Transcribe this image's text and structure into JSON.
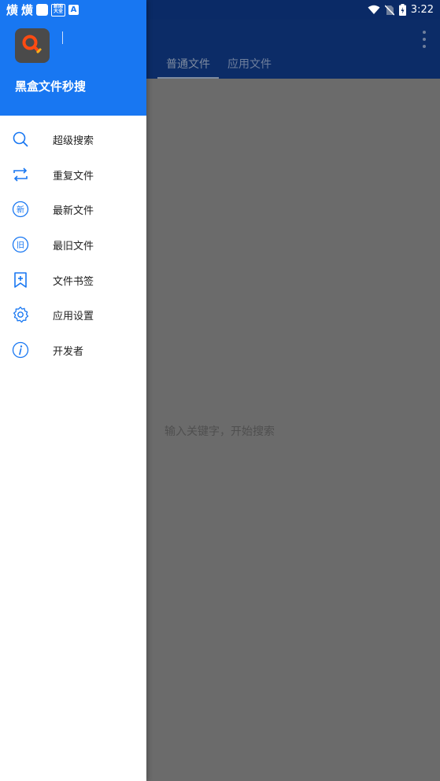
{
  "status_bar": {
    "left_text_1": "熿",
    "left_text_2": "熿",
    "badge_a": "A",
    "badge_mini": "新闻大全",
    "time": "3:22",
    "icons": [
      "wifi-icon",
      "no-sim-icon",
      "battery-charging-icon"
    ]
  },
  "app": {
    "tabs": [
      {
        "label": "普通文件",
        "active": true
      },
      {
        "label": "应用文件",
        "active": false
      }
    ],
    "empty_hint": "输入关键字，开始搜索"
  },
  "drawer": {
    "app_name": "黑盒文件秒搜",
    "logo_icon": "search-magnifier-logo",
    "accent_color": "#1877f2",
    "items": [
      {
        "label": "超级搜索",
        "icon": "search-icon"
      },
      {
        "label": "重复文件",
        "icon": "repeat-icon"
      },
      {
        "label": "最新文件",
        "icon": "new-badge-icon",
        "icon_text": "新"
      },
      {
        "label": "最旧文件",
        "icon": "old-badge-icon",
        "icon_text": "旧"
      },
      {
        "label": "文件书签",
        "icon": "bookmark-icon"
      },
      {
        "label": "应用设置",
        "icon": "gear-icon"
      },
      {
        "label": "开发者",
        "icon": "info-icon"
      }
    ]
  }
}
